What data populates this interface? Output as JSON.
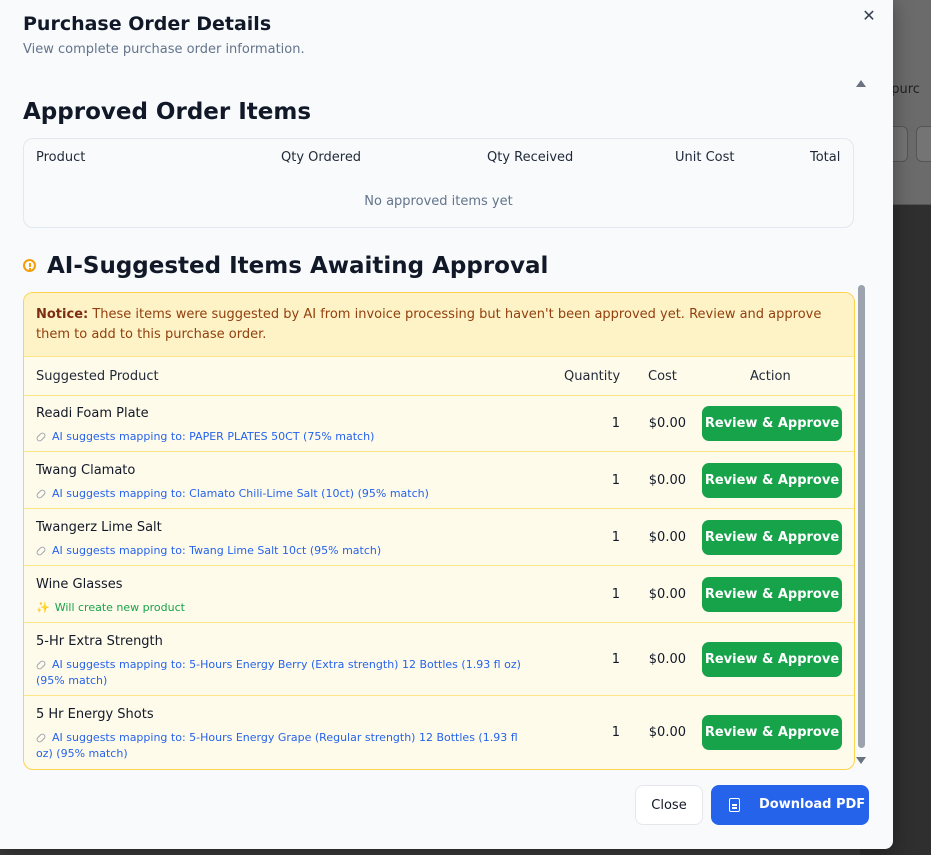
{
  "background": {
    "partial_text": "t purc"
  },
  "modal": {
    "title": "Purchase Order Details",
    "subtitle": "View complete purchase order information.",
    "close_icon": "close-icon"
  },
  "approved": {
    "heading": "Approved Order Items",
    "columns": [
      "Product",
      "Qty Ordered",
      "Qty Received",
      "Unit Cost",
      "Total"
    ],
    "empty_message": "No approved items yet"
  },
  "ai": {
    "heading": "AI-Suggested Items Awaiting Approval",
    "icon": "alert-circle-icon",
    "notice_label": "Notice:",
    "notice_text": " These items were suggested by AI from invoice processing but haven't been approved yet. Review and approve them to add to this purchase order.",
    "columns": {
      "product": "Suggested Product",
      "quantity": "Quantity",
      "cost": "Cost",
      "action": "Action"
    },
    "rows": [
      {
        "name": "Readi Foam Plate",
        "suggestion": "AI suggests mapping to: PAPER PLATES 50CT (75% match)",
        "kind": "mapping",
        "quantity": "1",
        "cost": "$0.00",
        "action": "Review & Approve"
      },
      {
        "name": "Twang Clamato",
        "suggestion": "AI suggests mapping to: Clamato Chili-Lime Salt (10ct) (95% match)",
        "kind": "mapping",
        "quantity": "1",
        "cost": "$0.00",
        "action": "Review & Approve"
      },
      {
        "name": "Twangerz Lime Salt",
        "suggestion": "AI suggests mapping to: Twang Lime Salt 10ct (95% match)",
        "kind": "mapping",
        "quantity": "1",
        "cost": "$0.00",
        "action": "Review & Approve"
      },
      {
        "name": "Wine Glasses",
        "suggestion": "Will create new product",
        "kind": "new",
        "quantity": "1",
        "cost": "$0.00",
        "action": "Review & Approve"
      },
      {
        "name": "5-Hr Extra Strength",
        "suggestion": "AI suggests mapping to: 5-Hours Energy Berry (Extra strength) 12 Bottles (1.93 fl oz) (95% match)",
        "kind": "mapping",
        "quantity": "1",
        "cost": "$0.00",
        "action": "Review & Approve"
      },
      {
        "name": "5 Hr Energy Shots",
        "suggestion": "AI suggests mapping to: 5-Hours Energy Grape (Regular strength) 12 Bottles (1.93 fl oz) (95% match)",
        "kind": "mapping",
        "quantity": "1",
        "cost": "$0.00",
        "action": "Review & Approve"
      }
    ]
  },
  "footer": {
    "close_label": "Close",
    "download_label": "Download PDF"
  },
  "colors": {
    "approve": "#16a34a",
    "primary": "#2563eb",
    "notice_bg": "#fef3c7",
    "warning": "#f59e0b"
  }
}
